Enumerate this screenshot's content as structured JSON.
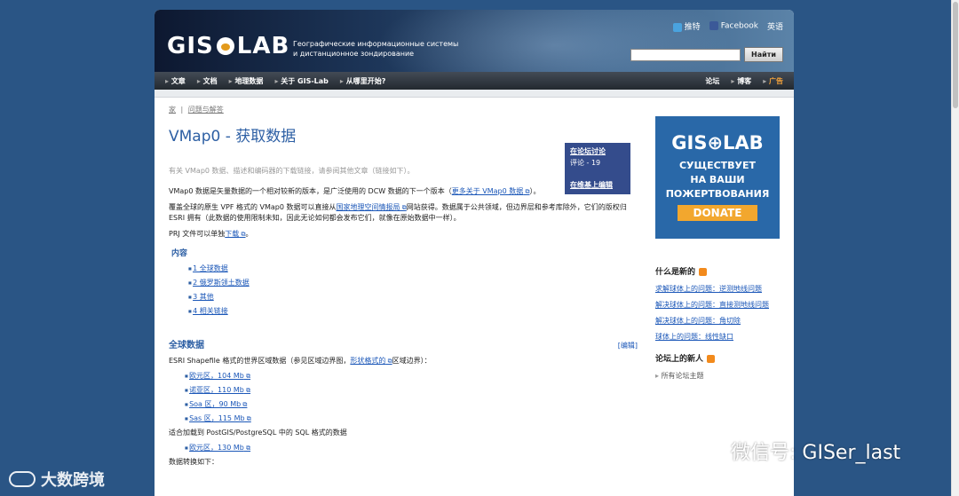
{
  "header": {
    "logo_left": "GIS",
    "logo_right": "LAB",
    "tagline_line1": "Географические информационные системы",
    "tagline_line2": "и дистанционное зондирование",
    "social": [
      "推特",
      "Facebook",
      "英语"
    ],
    "search_button": "Найти"
  },
  "nav": {
    "left": [
      "文章",
      "文档",
      "地理数据",
      "关于 GIS-Lab",
      "从哪里开始?"
    ],
    "right": [
      "论坛",
      "博客"
    ],
    "ad": "广告"
  },
  "breadcrumb": [
    "家",
    "|",
    "问题与解答"
  ],
  "page": {
    "title": "VMap0 - 获取数据",
    "intro": "有关 VMap0 数据、描述和编码器的下载链接，请参阅其他文章（链接如下）。",
    "para1_text": "VMap0 数据是矢量数据的一个相对较新的版本，是广泛使用的 DCW 数据的下一个版本（",
    "para1_link": "更多关于 VMap0 数据",
    "para1_end": "）。",
    "para2_text": "覆盖全球的原生 VPF 格式的 VMap0 数据可以直接从",
    "para2_link": "国家地理空间情报局",
    "para2_end": "网站获得。数据属于公共领域，但边界层和参考库除外，它们的版权归 ESRI 拥有（此数据的使用限制未知，因此无论如何都会发布它们，就像在原始数据中一样）。",
    "para3_text": "PRJ 文件可以单独",
    "para3_link": "下载",
    "para3_end": "。"
  },
  "infobox": {
    "discuss": "在论坛讨论",
    "comments": "评论 - 19",
    "wiki": "在维基上编辑"
  },
  "toc": {
    "title": "内容",
    "items": [
      "1 全球数据",
      "2 俄罗斯领土数据",
      "3 其他",
      "4 相关链接"
    ]
  },
  "section": {
    "title": "全球数据",
    "edit": "[编辑]",
    "desc_text": "ESRI Shapefile 格式的世界区域数据（参见区域边界图，",
    "desc_link": "形状格式的",
    "desc_end": "区域边界）：",
    "files": [
      "欧元区，104 Mb",
      "诺亚区，110 Mb",
      "Soa 区，90 Mb",
      "Sas 区，115 Mb"
    ],
    "sql_text": "适合加载到 PostGIS/PostgreSQL 中的 SQL 格式的数据",
    "sql_files": [
      "欧元区，130 Mb"
    ],
    "convert_text": "数据转换如下："
  },
  "aside": {
    "ad_logo": "GIS⊕LAB",
    "ad_line1": "СУЩЕСТВУЕТ",
    "ad_line2": "НА ВАШИ",
    "ad_line3": "ПОЖЕРТВОВАНИЯ",
    "ad_button": "DONATE",
    "new_title": "什么是新的",
    "new_items": [
      "求解球体上的问题：逆测地线问题",
      "解决球体上的问题：直接测地线问题",
      "解决球体上的问题：角切除",
      "球体上的问题：线性缺口"
    ],
    "forum_title": "论坛上的新人",
    "forum_items": [
      "所有论坛主题"
    ]
  },
  "watermark": "微信号: GISer_last",
  "brand": "大数跨境"
}
